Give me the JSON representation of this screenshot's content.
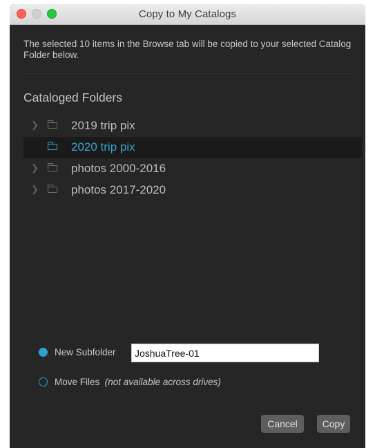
{
  "window": {
    "title": "Copy to My Catalogs"
  },
  "message": "The selected 10 items in the Browse tab will be copied to your selected Catalog Folder below.",
  "section": {
    "title": "Cataloged Folders"
  },
  "folders": [
    {
      "label": "2019 trip pix",
      "expandable": true,
      "selected": false
    },
    {
      "label": "2020 trip pix",
      "expandable": false,
      "selected": true
    },
    {
      "label": "photos 2000-2016",
      "expandable": true,
      "selected": false
    },
    {
      "label": "photos 2017-2020",
      "expandable": true,
      "selected": false
    }
  ],
  "options": {
    "new_subfolder": {
      "label": "New Subfolder",
      "selected": true,
      "value": "JoshuaTree-01"
    },
    "move_files": {
      "label": "Move Files",
      "note": "(not available across drives)",
      "selected": false
    }
  },
  "buttons": {
    "cancel": "Cancel",
    "copy": "Copy"
  },
  "icons": {
    "expand": "chevron-right-icon",
    "folder": "folder-icon"
  },
  "colors": {
    "accent": "#3aa3d3",
    "background": "#262626",
    "selected_row": "#1a1a1a"
  }
}
